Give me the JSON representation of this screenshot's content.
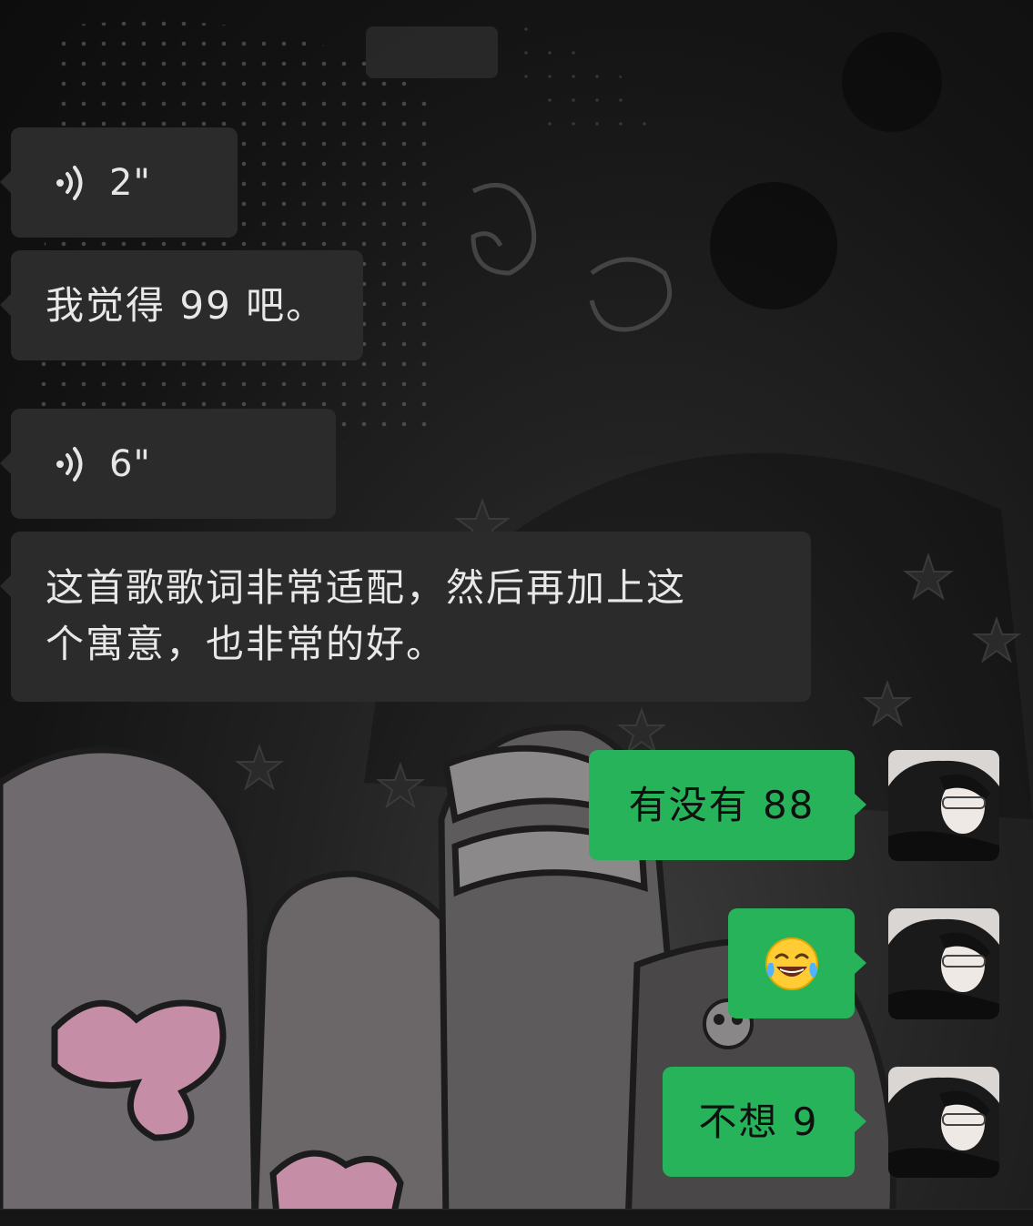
{
  "messages": {
    "m1": {
      "sender": "other",
      "type": "voice",
      "duration": "2\""
    },
    "m2": {
      "sender": "other",
      "type": "text",
      "text": "我觉得 99 吧。"
    },
    "m3": {
      "sender": "other",
      "type": "voice",
      "duration": "6\""
    },
    "m4": {
      "sender": "other",
      "type": "text",
      "lines": [
        "这首歌歌词非常适配，然后再加上这",
        "个寓意，也非常的好。"
      ]
    },
    "m5": {
      "sender": "self",
      "type": "text",
      "text": "有没有 88"
    },
    "m6": {
      "sender": "self",
      "type": "emoji",
      "emoji_name": "face-with-tears-of-joy"
    },
    "m7": {
      "sender": "self",
      "type": "text",
      "text": "不想 9"
    }
  },
  "colors": {
    "incoming_bubble": "#2b2b2b",
    "outgoing_bubble": "#27b35a",
    "background": "#141414"
  },
  "icons": {
    "voice": "voice-wave-icon",
    "avatar": "user-avatar-photo"
  }
}
